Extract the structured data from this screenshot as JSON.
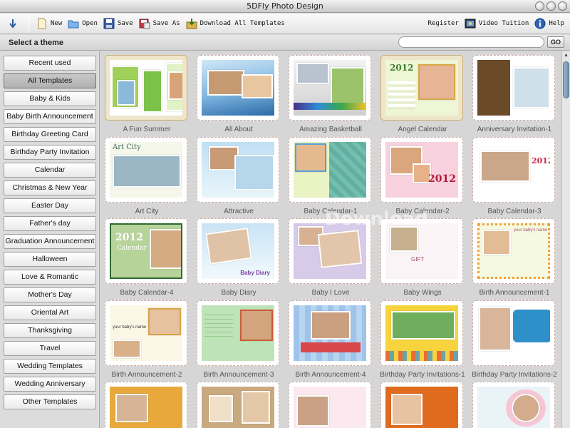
{
  "window": {
    "title": "5DFly Photo Design"
  },
  "toolbar": {
    "new": "New",
    "open": "Open",
    "save": "Save",
    "save_as": "Save As",
    "download_all": "Download All Templates",
    "register": "Register",
    "video_tuition": "Video Tuition",
    "help": "Help"
  },
  "themebar": {
    "label": "Select a theme",
    "search_value": "",
    "go": "GO"
  },
  "sidebar": {
    "items": [
      "Recent used",
      "All Templates",
      "Baby & Kids",
      "Baby Birth Announcement",
      "Birthday Greeting Card",
      "Birthday Party Invitation",
      "Calendar",
      "Christmas & New Year",
      "Easter Day",
      "Father's day",
      "Graduation Announcement",
      "Halloween",
      "Love & Romantic",
      "Mother's Day",
      "Oriental Art",
      "Thanksgiving",
      "Travel",
      "Wedding Templates",
      "Wedding Anniversary",
      "Other Templates"
    ],
    "active": "All Templates"
  },
  "templates": [
    {
      "caption": "A Fun Summer"
    },
    {
      "caption": "All About"
    },
    {
      "caption": "Amazing Basketball"
    },
    {
      "caption": "Angel Calendar"
    },
    {
      "caption": "Anniversary Invitation-1"
    },
    {
      "caption": "Art City"
    },
    {
      "caption": "Attractive"
    },
    {
      "caption": "Baby Calendar-1"
    },
    {
      "caption": "Baby Calendar-2"
    },
    {
      "caption": "Baby Calendar-3"
    },
    {
      "caption": "Baby Calendar-4"
    },
    {
      "caption": "Baby Diary"
    },
    {
      "caption": "Baby I Love"
    },
    {
      "caption": "Baby Wings"
    },
    {
      "caption": "Birth Announcement-1"
    },
    {
      "caption": "Birth Announcement-2"
    },
    {
      "caption": "Birth Announcement-3"
    },
    {
      "caption": "Birth Announcement-4"
    },
    {
      "caption": "Birthday Party Invitations-1"
    },
    {
      "caption": "Birthday Party Invitations-2"
    }
  ],
  "card_text": {
    "year": "2012",
    "calendar": "Calendar",
    "art_city": "Art City",
    "baby_diary": "Baby Diary",
    "your_babys_name": "your baby's name",
    "gift": "GIFT"
  },
  "watermark": "Download",
  "colors": {
    "accent_scroll": "#6e8eb3",
    "selected_card": "#efe5c9"
  }
}
